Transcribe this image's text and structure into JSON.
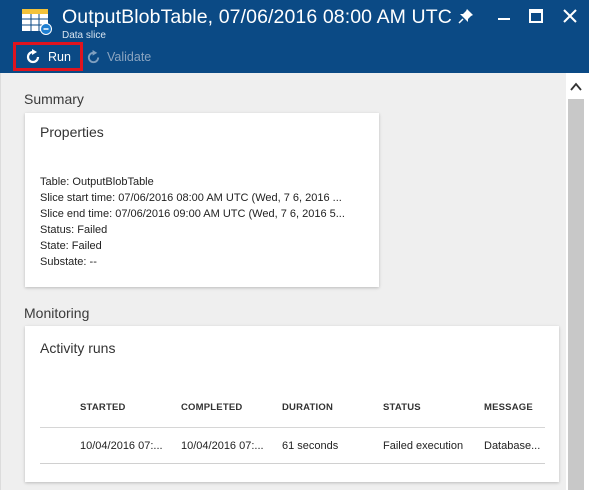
{
  "header": {
    "title": "OutputBlobTable, 07/06/2016 08:00 AM UTC",
    "subtitle": "Data slice",
    "icons": {
      "table": "table-icon",
      "pin": "pin-icon",
      "maximize": "maximize-icon",
      "close": "close-icon"
    }
  },
  "toolbar": {
    "run_label": "Run",
    "validate_label": "Validate",
    "run_icon": "refresh-icon",
    "validate_icon": "refresh-icon"
  },
  "summary": {
    "section_title": "Summary",
    "card_title": "Properties",
    "properties": [
      "Table: OutputBlobTable",
      "Slice start time: 07/06/2016 08:00 AM UTC (Wed, 7 6, 2016 ...",
      "Slice end time: 07/06/2016 09:00 AM UTC (Wed, 7 6, 2016 5...",
      "Status: Failed",
      "State: Failed",
      "Substate: --"
    ]
  },
  "monitoring": {
    "section_title": "Monitoring",
    "card_title": "Activity runs",
    "columns": [
      "STARTED",
      "COMPLETED",
      "DURATION",
      "STATUS",
      "MESSAGE"
    ],
    "rows": [
      [
        "10/04/2016 07:...",
        "10/04/2016 07:...",
        "61 seconds",
        "Failed execution",
        "Database..."
      ]
    ]
  },
  "colors": {
    "header_bg": "#0b4a85",
    "run_highlight": "#e0141e",
    "content_bg": "#efefef"
  }
}
